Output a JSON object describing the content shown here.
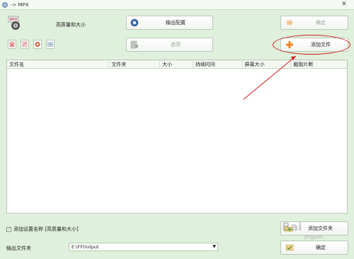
{
  "window": {
    "title": "-> MP4",
    "close_glyph": "✕"
  },
  "profile": {
    "label": "高质量和大小"
  },
  "buttons": {
    "output_config": "输出配置",
    "options": "选项",
    "ok": "确定",
    "add_file": "添加文件",
    "add_folder": "添加文件夹",
    "ok_bottom": "确定"
  },
  "file_list": {
    "columns": [
      "文件名",
      "文件夹",
      "大小",
      "持续时间",
      "屏幕大小",
      "截取片断"
    ]
  },
  "bottom": {
    "append_checkbox_label": "添加设置名称 [高质量和大小]",
    "append_checked": true,
    "output_folder_label": "输出文件夹",
    "output_folder_value": "E:\\FFOutput"
  },
  "watermark": {
    "brand": "Bai",
    "sub": "jingyan"
  },
  "colors": {
    "annotation": "#d11d1d",
    "background": "#dff0dc",
    "add_icon": "#f0861f"
  }
}
